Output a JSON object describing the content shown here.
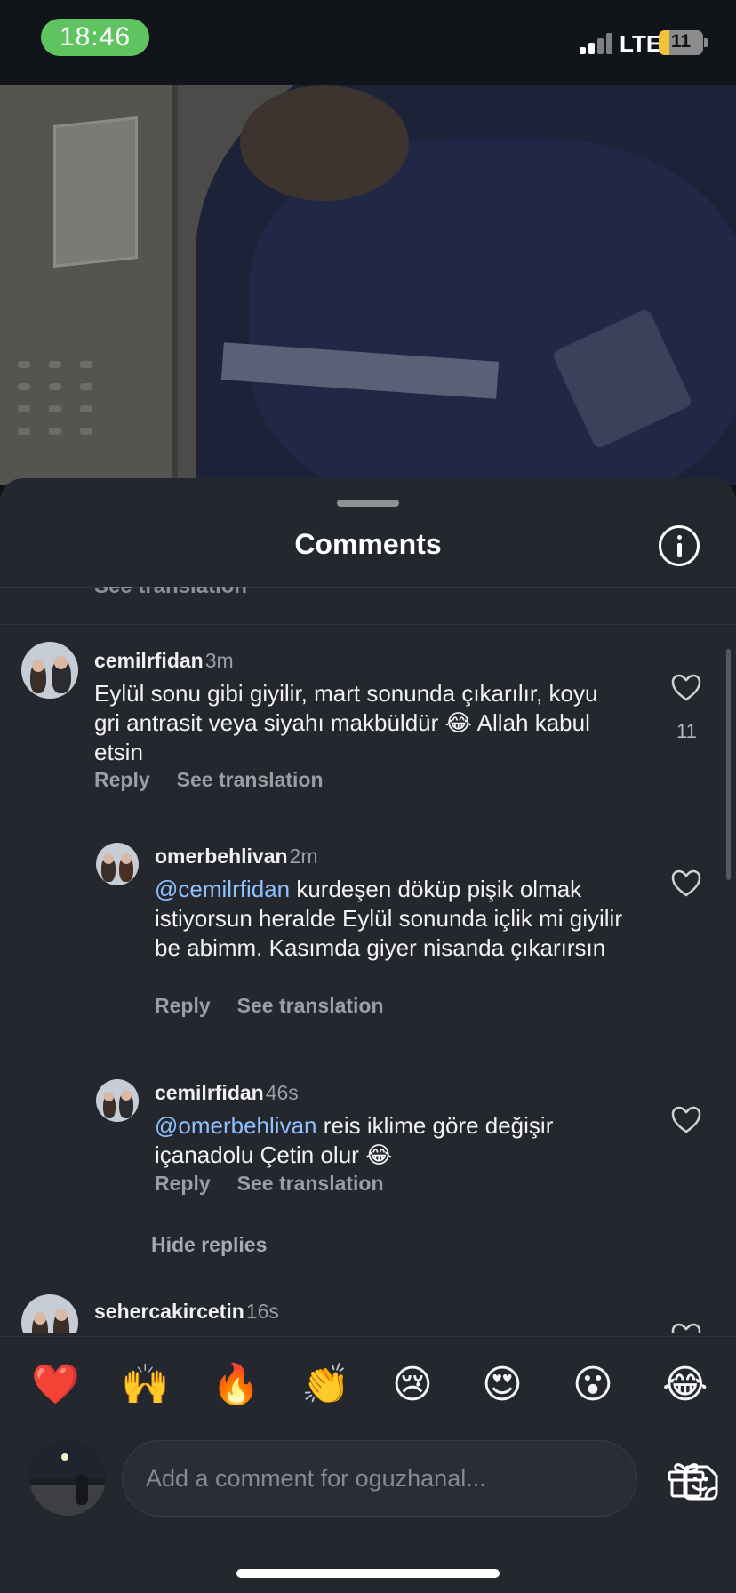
{
  "status_bar": {
    "time": "18:46",
    "network": "LTE",
    "battery": "11",
    "battery_level_percent": 11,
    "icons": [
      "signal-icon",
      "battery-charging-icon"
    ]
  },
  "sheet": {
    "title": "Comments",
    "info_icon": "info-icon",
    "prev_translation": "See translation"
  },
  "comments": [
    {
      "username": "cemilrfidan",
      "age": "3m",
      "text": "Eylül sonu gibi giyilir, mart sonunda çıkarılır, koyu gri antrasit veya siyahı makbüldür 😂 Allah kabul etsin",
      "reply_label": "Reply",
      "translate_label": "See translation",
      "likes": "11"
    },
    {
      "username": "omerbehlivan",
      "age": "2m",
      "mention": "@cemilrfidan",
      "text": " kurdeşen döküp pişik olmak istiyorsun heralde Eylül sonunda içlik mi giyilir be abimm. Kasımda giyer nisanda çıkarırsın",
      "reply_label": "Reply",
      "translate_label": "See translation"
    },
    {
      "username": "cemilrfidan",
      "age": "46s",
      "mention": "@omerbehlivan",
      "text": " reis iklime göre değişir içanadolu Çetin olur 😂",
      "reply_label": "Reply",
      "translate_label": "See translation"
    },
    {
      "username": "sehercakircetin",
      "age": "16s"
    }
  ],
  "hide_replies_label": "Hide replies",
  "emoji_bar": [
    "❤️",
    "🙌",
    "🔥",
    "👏",
    "😢",
    "😍",
    "😮",
    "😂"
  ],
  "input": {
    "placeholder": "Add a comment for oguzhanal...",
    "sticker_icon": "sticker-icon",
    "gift_icon": "gift-icon"
  }
}
